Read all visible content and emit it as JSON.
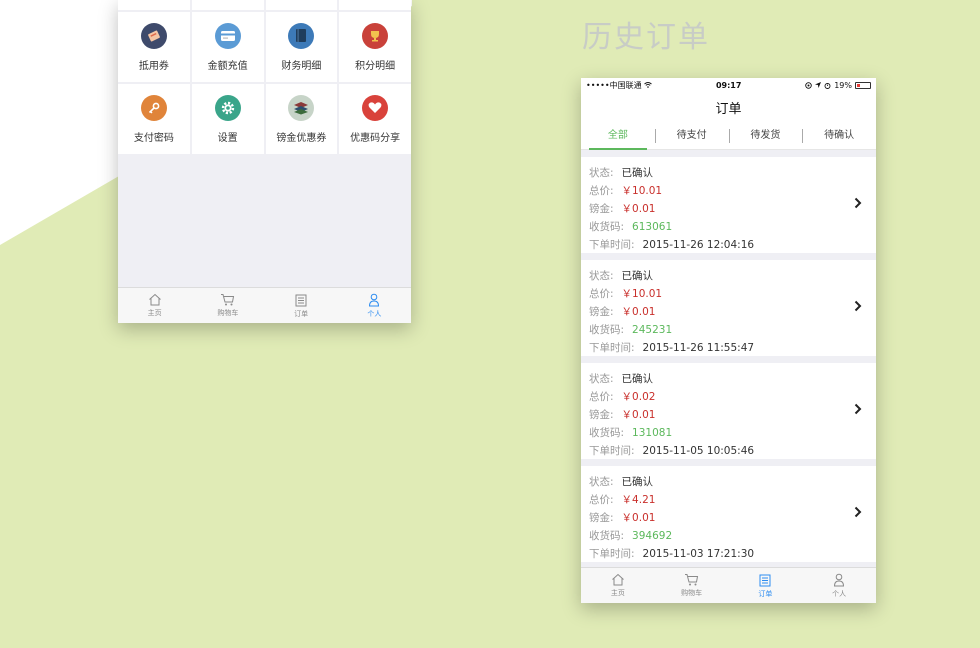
{
  "heading": "历史订单",
  "left_phone": {
    "grid": [
      {
        "label": "抵用券",
        "icon": "ticket-icon",
        "color": "#3e4a6b"
      },
      {
        "label": "金额充值",
        "icon": "card-icon",
        "color": "#5b9bd5"
      },
      {
        "label": "财务明细",
        "icon": "book-icon",
        "color": "#3d7ab8"
      },
      {
        "label": "积分明细",
        "icon": "trophy-icon",
        "color": "#c9413a"
      },
      {
        "label": "支付密码",
        "icon": "key-icon",
        "color": "#e0843a"
      },
      {
        "label": "设置",
        "icon": "gear-icon",
        "color": "#3aa58a"
      },
      {
        "label": "镑金优惠券",
        "icon": "stack-icon",
        "color": "#c7d4c8"
      },
      {
        "label": "优惠码分享",
        "icon": "heart-icon",
        "color": "#d9423b"
      }
    ],
    "tabbar": [
      {
        "label": "主页",
        "icon": "home-icon"
      },
      {
        "label": "购物车",
        "icon": "cart-icon"
      },
      {
        "label": "订单",
        "icon": "order-icon"
      },
      {
        "label": "个人",
        "icon": "person-icon"
      }
    ],
    "active_tab": "个人"
  },
  "right_phone": {
    "status": {
      "carrier": "•••••中国联通",
      "time": "09:17",
      "battery": "19%",
      "battery_level": 0.19
    },
    "title": "订单",
    "tabs": [
      "全部",
      "待支付",
      "待发货",
      "待确认"
    ],
    "active_tab": "全部",
    "labels": {
      "status": "状态:",
      "total": "总价:",
      "pound": "镑金:",
      "code": "收货码:",
      "time": "下单时间:"
    },
    "orders": [
      {
        "status": "已确认",
        "total": "￥10.01",
        "pound": "￥0.01",
        "code": "613061",
        "time": "2015-11-26 12:04:16"
      },
      {
        "status": "已确认",
        "total": "￥10.01",
        "pound": "￥0.01",
        "code": "245231",
        "time": "2015-11-26 11:55:47"
      },
      {
        "status": "已确认",
        "total": "￥0.02",
        "pound": "￥0.01",
        "code": "131081",
        "time": "2015-11-05 10:05:46"
      },
      {
        "status": "已确认",
        "total": "￥4.21",
        "pound": "￥0.01",
        "code": "394692",
        "time": "2015-11-03 17:21:30"
      }
    ],
    "tabbar": [
      {
        "label": "主页",
        "icon": "home-icon"
      },
      {
        "label": "购物车",
        "icon": "cart-icon"
      },
      {
        "label": "订单",
        "icon": "order-icon"
      },
      {
        "label": "个人",
        "icon": "person-icon"
      }
    ],
    "active_bottom_tab": "订单"
  },
  "colors": {
    "background": "#e0ebb6",
    "accent_green": "#5cb85c",
    "accent_blue": "#2d8cf0",
    "price_red": "#c9302c"
  }
}
